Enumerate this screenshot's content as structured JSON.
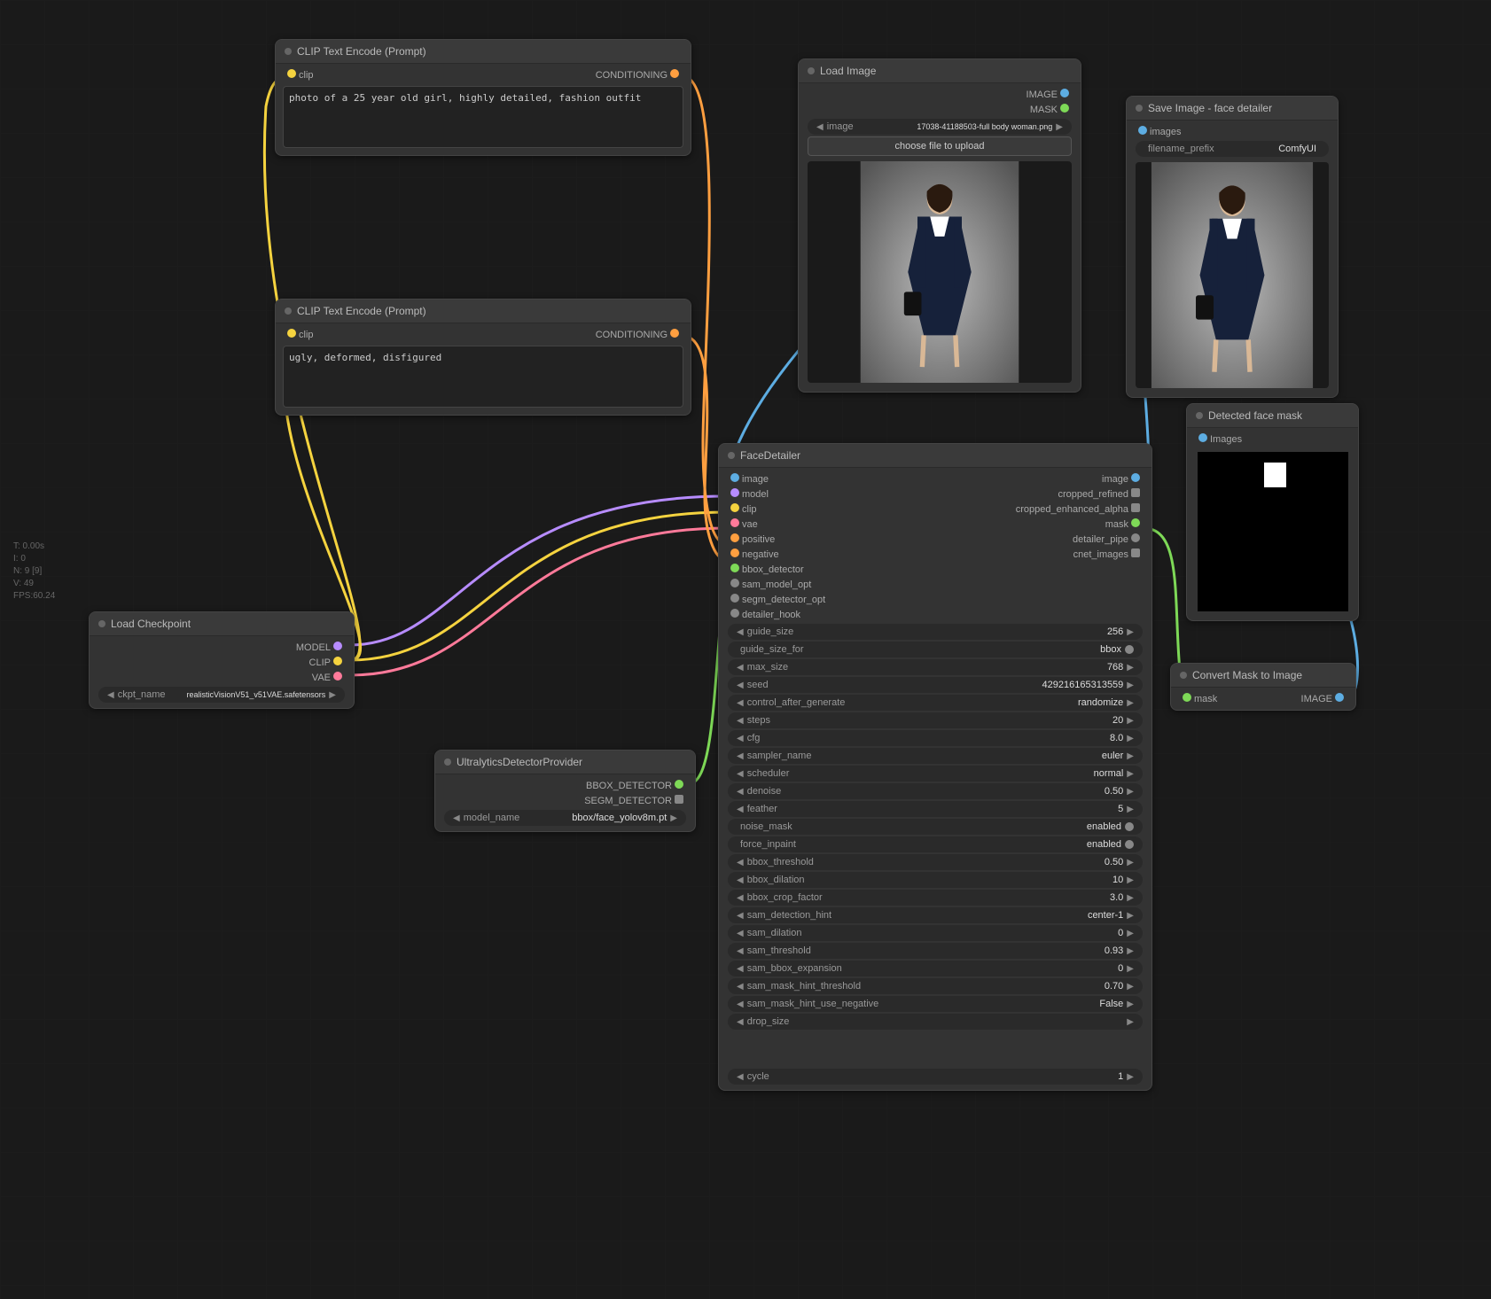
{
  "stats": {
    "t": "T: 0.00s",
    "i": "I: 0",
    "n": "N: 9 [9]",
    "v": "V: 49",
    "fps": "FPS:60.24"
  },
  "nodes": {
    "clipPos": {
      "title": "CLIP Text Encode (Prompt)",
      "in_clip": "clip",
      "out_cond": "CONDITIONING",
      "text": "photo of a 25 year old girl, highly detailed, fashion outfit"
    },
    "clipNeg": {
      "title": "CLIP Text Encode (Prompt)",
      "in_clip": "clip",
      "out_cond": "CONDITIONING",
      "text": "ugly, deformed, disfigured"
    },
    "loadCkpt": {
      "title": "Load Checkpoint",
      "out_model": "MODEL",
      "out_clip": "CLIP",
      "out_vae": "VAE",
      "widget_label": "ckpt_name",
      "widget_value": "realisticVisionV51_v51VAE.safetensors"
    },
    "ultraDet": {
      "title": "UltralyticsDetectorProvider",
      "out_bbox": "BBOX_DETECTOR",
      "out_segm": "SEGM_DETECTOR",
      "widget_label": "model_name",
      "widget_value": "bbox/face_yolov8m.pt"
    },
    "loadImage": {
      "title": "Load Image",
      "out_image": "IMAGE",
      "out_mask": "MASK",
      "file_label": "image",
      "file_value": "17038-41188503-full body woman.png",
      "upload": "choose file to upload"
    },
    "saveImage": {
      "title": "Save Image - face detailer",
      "in_images": "images",
      "prefix_label": "filename_prefix",
      "prefix_value": "ComfyUI"
    },
    "detectedMask": {
      "title": "Detected face mask",
      "in_images": "Images"
    },
    "convertMask": {
      "title": "Convert Mask to Image",
      "in_mask": "mask",
      "out_image": "IMAGE"
    },
    "faceDetailer": {
      "title": "FaceDetailer",
      "inputs": [
        "image",
        "model",
        "clip",
        "vae",
        "positive",
        "negative",
        "bbox_detector",
        "sam_model_opt",
        "segm_detector_opt",
        "detailer_hook"
      ],
      "outputs": [
        "image",
        "cropped_refined",
        "cropped_enhanced_alpha",
        "mask",
        "detailer_pipe",
        "cnet_images"
      ],
      "widgets": [
        {
          "name": "guide_size",
          "value": "256",
          "type": "num"
        },
        {
          "name": "guide_size_for",
          "value": "bbox",
          "type": "toggle"
        },
        {
          "name": "max_size",
          "value": "768",
          "type": "num"
        },
        {
          "name": "seed",
          "value": "429216165313559",
          "type": "num"
        },
        {
          "name": "control_after_generate",
          "value": "randomize",
          "type": "sel"
        },
        {
          "name": "steps",
          "value": "20",
          "type": "num"
        },
        {
          "name": "cfg",
          "value": "8.0",
          "type": "num"
        },
        {
          "name": "sampler_name",
          "value": "euler",
          "type": "sel"
        },
        {
          "name": "scheduler",
          "value": "normal",
          "type": "sel"
        },
        {
          "name": "denoise",
          "value": "0.50",
          "type": "num"
        },
        {
          "name": "feather",
          "value": "5",
          "type": "num"
        },
        {
          "name": "noise_mask",
          "value": "enabled",
          "type": "toggle"
        },
        {
          "name": "force_inpaint",
          "value": "enabled",
          "type": "toggle"
        },
        {
          "name": "bbox_threshold",
          "value": "0.50",
          "type": "num"
        },
        {
          "name": "bbox_dilation",
          "value": "10",
          "type": "num"
        },
        {
          "name": "bbox_crop_factor",
          "value": "3.0",
          "type": "num"
        },
        {
          "name": "sam_detection_hint",
          "value": "center-1",
          "type": "sel"
        },
        {
          "name": "sam_dilation",
          "value": "0",
          "type": "num"
        },
        {
          "name": "sam_threshold",
          "value": "0.93",
          "type": "num"
        },
        {
          "name": "sam_bbox_expansion",
          "value": "0",
          "type": "num"
        },
        {
          "name": "sam_mask_hint_threshold",
          "value": "0.70",
          "type": "num"
        },
        {
          "name": "sam_mask_hint_use_negative",
          "value": "False",
          "type": "sel"
        },
        {
          "name": "drop_size",
          "value": "",
          "type": "num"
        }
      ],
      "bottom_widget": {
        "name": "cycle",
        "value": "1"
      }
    }
  }
}
